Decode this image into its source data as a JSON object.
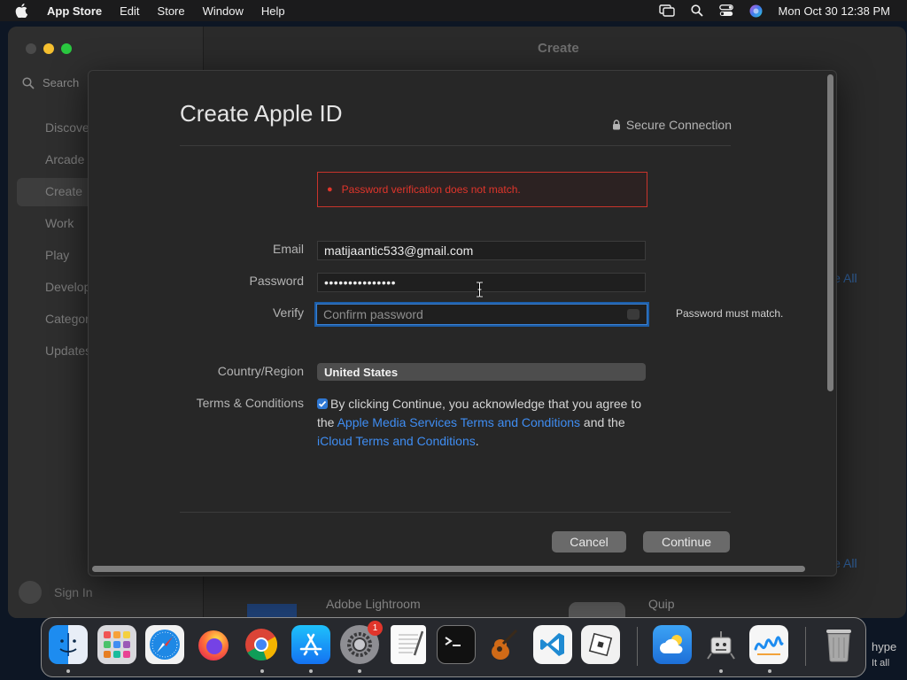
{
  "menubar": {
    "app_name": "App Store",
    "items": [
      "Edit",
      "Store",
      "Window",
      "Help"
    ],
    "clock": "Mon Oct 30  12:38 PM",
    "status_icons": [
      "screen-mirroring-icon",
      "spotlight-search-icon",
      "control-center-icon",
      "siri-icon"
    ]
  },
  "app": {
    "window_title": "Create",
    "search_label": "Search",
    "sidebar_items": [
      "Discover",
      "Arcade",
      "Create",
      "Work",
      "Play",
      "Develop",
      "Categories",
      "Updates"
    ],
    "sign_in": "Sign In",
    "see_all": "See All",
    "bottom_apps": [
      "Adobe Lightroom",
      "Quip"
    ]
  },
  "sheet": {
    "title": "Create Apple ID",
    "secure_label": "Secure Connection",
    "error": "Password verification does not match.",
    "email_label": "Email",
    "email_value": "matijaantic533@gmail.com",
    "password_label": "Password",
    "password_value": "•••••••••••••••",
    "verify_label": "Verify",
    "verify_placeholder": "Confirm password",
    "verify_hint": "Password must match.",
    "country_label": "Country/Region",
    "country_value": "United States",
    "terms_label": "Terms & Conditions",
    "terms_text_1": "By clicking Continue, you acknowledge that you agree to the ",
    "terms_link_1": "Apple Media Services Terms and Conditions",
    "terms_text_2": " and the ",
    "terms_link_2": "iCloud Terms and Conditions",
    "terms_text_3": ".",
    "terms_checked": true,
    "cancel": "Cancel",
    "continue": "Continue"
  },
  "dock": {
    "apps": [
      "Finder",
      "Launchpad",
      "Safari",
      "Firefox",
      "Chrome",
      "App Store",
      "System Settings",
      "TextEdit",
      "Terminal",
      "GarageBand",
      "Visual Studio Code",
      "Roblox",
      "Weather",
      "Automator",
      "Freeform",
      "Trash"
    ],
    "settings_badge": "1",
    "stray_text": [
      "hype",
      "It all"
    ]
  },
  "colors": {
    "accent": "#3a7fd0",
    "error": "#e0352b",
    "link": "#3f8df2"
  }
}
